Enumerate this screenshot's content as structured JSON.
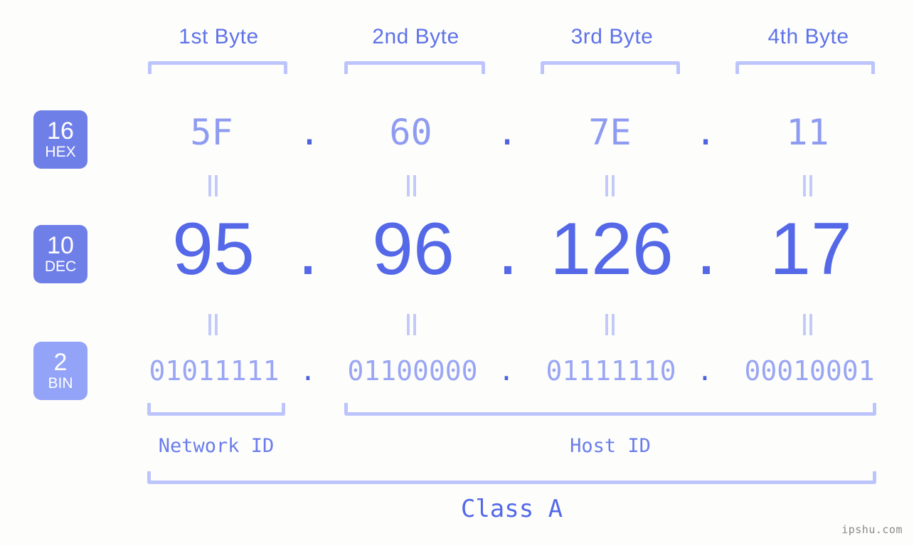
{
  "meta": {
    "background": "#fdfefb",
    "accent_strong": "#5468e8",
    "accent_mid": "#8e9bf2",
    "accent_light": "#bcc4fb",
    "badge_dark": "#6f7fe8",
    "badge_light": "#93a3f7"
  },
  "byte_headers": [
    {
      "label": "1st Byte"
    },
    {
      "label": "2nd Byte"
    },
    {
      "label": "3rd Byte"
    },
    {
      "label": "4th Byte"
    }
  ],
  "bases": [
    {
      "number": "16",
      "name": "HEX",
      "color": "#6f7fe8"
    },
    {
      "number": "10",
      "name": "DEC",
      "color": "#6f7fe8"
    },
    {
      "number": "2",
      "name": "BIN",
      "color": "#93a3f7"
    }
  ],
  "rows": {
    "hex": {
      "values": [
        "5F",
        "60",
        "7E",
        "11"
      ],
      "separator": "."
    },
    "dec": {
      "values": [
        "95",
        "96",
        "126",
        "17"
      ],
      "separator": "."
    },
    "bin": {
      "values": [
        "01011111",
        "01100000",
        "01111110",
        "00010001"
      ],
      "separator": "."
    }
  },
  "segments": {
    "network_id": "Network ID",
    "host_id": "Host ID",
    "class": "Class A"
  },
  "watermark": "ipshu.com"
}
